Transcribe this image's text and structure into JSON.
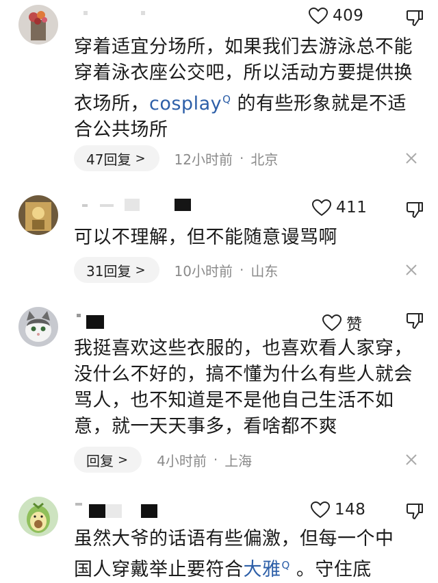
{
  "comments": [
    {
      "like_count": "409",
      "text_before": "穿着适宜分场所，如果我们去游泳总不能穿着泳衣座公交吧，所以活动方要提供换衣场所，",
      "keyword": "cosplay",
      "text_after": " 的有些形象就是不适合公共场所",
      "reply_label": "47回复",
      "time": "12小时前",
      "location": "北京"
    },
    {
      "like_count": "411",
      "text": "可以不理解，但不能随意谩骂啊",
      "reply_label": "31回复",
      "time": "10小时前",
      "location": "山东"
    },
    {
      "like_count": "赞",
      "text": "我挺喜欢这些衣服的，也喜欢看人家穿，没什么不好的，搞不懂为什么有些人就会骂人，也不知道是不是他自己生活不如意，就一天天事多，看啥都不爽",
      "reply_label": "回复",
      "time": "4小时前",
      "location": "上海"
    },
    {
      "like_count": "148",
      "text_before": "虽然大爷的话语有些偏激，但每一个中国人穿戴举止要符合",
      "keyword": "大雅",
      "text_after": " 。守住底"
    }
  ],
  "icons": {
    "like": "heart-outline-icon",
    "dislike": "thumbs-down-icon",
    "keyword_search": "search-mark-icon",
    "reply_arrow": "chevron-right-icon",
    "dismiss": "close-icon"
  },
  "colors": {
    "keyword": "#2d5fa8",
    "meta": "#8a8a8a",
    "reply_pill_bg": "#f3f3f3"
  }
}
